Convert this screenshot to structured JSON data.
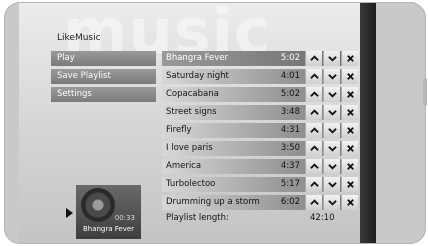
{
  "app": {
    "title": "LikeMusic",
    "watermark": "music"
  },
  "menu": {
    "items": [
      {
        "label": "Play"
      },
      {
        "label": "Save Playlist"
      },
      {
        "label": "Settings"
      }
    ]
  },
  "playlist": {
    "tracks": [
      {
        "title": "Bhangra Fever",
        "duration": "5:02",
        "selected": true
      },
      {
        "title": "Saturday night",
        "duration": "4:01"
      },
      {
        "title": "Copacabana",
        "duration": "5:02"
      },
      {
        "title": "Street signs",
        "duration": "3:48"
      },
      {
        "title": "Firefly",
        "duration": "4:31"
      },
      {
        "title": "I love paris",
        "duration": "3:50"
      },
      {
        "title": "America",
        "duration": "4:37"
      },
      {
        "title": "Turbolectoo",
        "duration": "5:17"
      },
      {
        "title": "Drumming up a storm",
        "duration": "6:02"
      }
    ],
    "length_label": "Playlist length:",
    "length_value": "42:10",
    "icons": {
      "up": "chevron-up-icon",
      "down": "chevron-down-icon",
      "remove": "close-icon"
    }
  },
  "now_playing": {
    "title": "Bhangra Fever",
    "elapsed": "00:33"
  },
  "colors": {
    "accent": "#7a7a7a",
    "selected_row": "#6a6a6a"
  }
}
